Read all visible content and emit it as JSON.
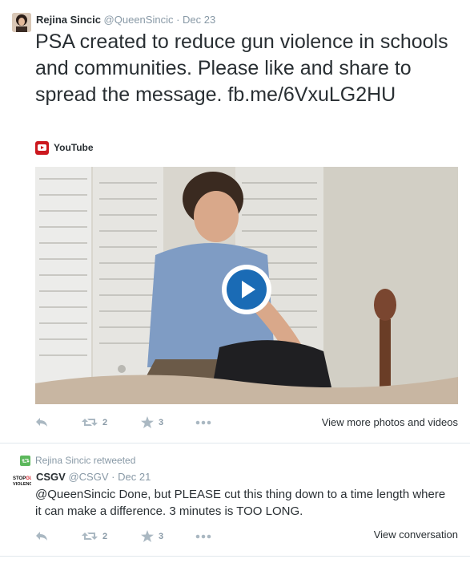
{
  "tweet1": {
    "name": "Rejina Sincic",
    "handle": "@QueenSincic",
    "dot": "·",
    "time": "Dec 23",
    "text": "PSA created to reduce gun violence in schools and communities. Please like and share to spread the message. fb.me/6VxuLG2HU",
    "source": "YouTube",
    "retweets": "2",
    "favorites": "3",
    "view_more": "View more photos and videos"
  },
  "tweet2": {
    "retweeted_by": "Rejina Sincic retweeted",
    "avatar_text": "STOP GUN VIOLENCE",
    "name": "CSGV",
    "handle": "@CSGV",
    "dot": "·",
    "time": "Dec 21",
    "text": "@QueenSincic Done, but PLEASE cut this thing down to a time length where it can make a difference. 3 minutes is TOO LONG.",
    "retweets": "2",
    "favorites": "3",
    "view_conversation": "View conversation"
  },
  "colors": {
    "accent": "#1a6bb5",
    "youtube": "#cc181e",
    "retweet_green": "#5cb85c",
    "muted": "#8899a6"
  }
}
